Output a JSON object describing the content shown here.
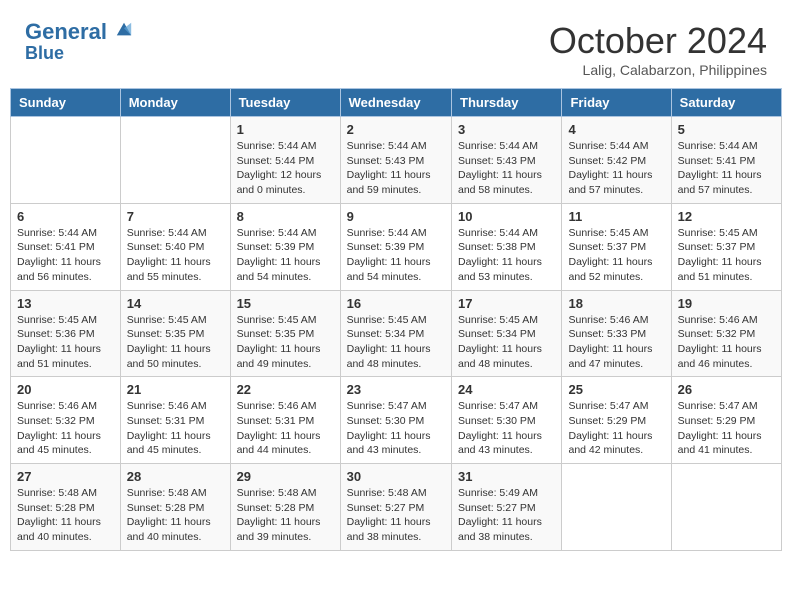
{
  "header": {
    "logo_line1": "General",
    "logo_line2": "Blue",
    "month_title": "October 2024",
    "subtitle": "Lalig, Calabarzon, Philippines"
  },
  "days_of_week": [
    "Sunday",
    "Monday",
    "Tuesday",
    "Wednesday",
    "Thursday",
    "Friday",
    "Saturday"
  ],
  "weeks": [
    [
      {
        "day": "",
        "content": ""
      },
      {
        "day": "",
        "content": ""
      },
      {
        "day": "1",
        "content": "Sunrise: 5:44 AM\nSunset: 5:44 PM\nDaylight: 12 hours and 0 minutes."
      },
      {
        "day": "2",
        "content": "Sunrise: 5:44 AM\nSunset: 5:43 PM\nDaylight: 11 hours and 59 minutes."
      },
      {
        "day": "3",
        "content": "Sunrise: 5:44 AM\nSunset: 5:43 PM\nDaylight: 11 hours and 58 minutes."
      },
      {
        "day": "4",
        "content": "Sunrise: 5:44 AM\nSunset: 5:42 PM\nDaylight: 11 hours and 57 minutes."
      },
      {
        "day": "5",
        "content": "Sunrise: 5:44 AM\nSunset: 5:41 PM\nDaylight: 11 hours and 57 minutes."
      }
    ],
    [
      {
        "day": "6",
        "content": "Sunrise: 5:44 AM\nSunset: 5:41 PM\nDaylight: 11 hours and 56 minutes."
      },
      {
        "day": "7",
        "content": "Sunrise: 5:44 AM\nSunset: 5:40 PM\nDaylight: 11 hours and 55 minutes."
      },
      {
        "day": "8",
        "content": "Sunrise: 5:44 AM\nSunset: 5:39 PM\nDaylight: 11 hours and 54 minutes."
      },
      {
        "day": "9",
        "content": "Sunrise: 5:44 AM\nSunset: 5:39 PM\nDaylight: 11 hours and 54 minutes."
      },
      {
        "day": "10",
        "content": "Sunrise: 5:44 AM\nSunset: 5:38 PM\nDaylight: 11 hours and 53 minutes."
      },
      {
        "day": "11",
        "content": "Sunrise: 5:45 AM\nSunset: 5:37 PM\nDaylight: 11 hours and 52 minutes."
      },
      {
        "day": "12",
        "content": "Sunrise: 5:45 AM\nSunset: 5:37 PM\nDaylight: 11 hours and 51 minutes."
      }
    ],
    [
      {
        "day": "13",
        "content": "Sunrise: 5:45 AM\nSunset: 5:36 PM\nDaylight: 11 hours and 51 minutes."
      },
      {
        "day": "14",
        "content": "Sunrise: 5:45 AM\nSunset: 5:35 PM\nDaylight: 11 hours and 50 minutes."
      },
      {
        "day": "15",
        "content": "Sunrise: 5:45 AM\nSunset: 5:35 PM\nDaylight: 11 hours and 49 minutes."
      },
      {
        "day": "16",
        "content": "Sunrise: 5:45 AM\nSunset: 5:34 PM\nDaylight: 11 hours and 48 minutes."
      },
      {
        "day": "17",
        "content": "Sunrise: 5:45 AM\nSunset: 5:34 PM\nDaylight: 11 hours and 48 minutes."
      },
      {
        "day": "18",
        "content": "Sunrise: 5:46 AM\nSunset: 5:33 PM\nDaylight: 11 hours and 47 minutes."
      },
      {
        "day": "19",
        "content": "Sunrise: 5:46 AM\nSunset: 5:32 PM\nDaylight: 11 hours and 46 minutes."
      }
    ],
    [
      {
        "day": "20",
        "content": "Sunrise: 5:46 AM\nSunset: 5:32 PM\nDaylight: 11 hours and 45 minutes."
      },
      {
        "day": "21",
        "content": "Sunrise: 5:46 AM\nSunset: 5:31 PM\nDaylight: 11 hours and 45 minutes."
      },
      {
        "day": "22",
        "content": "Sunrise: 5:46 AM\nSunset: 5:31 PM\nDaylight: 11 hours and 44 minutes."
      },
      {
        "day": "23",
        "content": "Sunrise: 5:47 AM\nSunset: 5:30 PM\nDaylight: 11 hours and 43 minutes."
      },
      {
        "day": "24",
        "content": "Sunrise: 5:47 AM\nSunset: 5:30 PM\nDaylight: 11 hours and 43 minutes."
      },
      {
        "day": "25",
        "content": "Sunrise: 5:47 AM\nSunset: 5:29 PM\nDaylight: 11 hours and 42 minutes."
      },
      {
        "day": "26",
        "content": "Sunrise: 5:47 AM\nSunset: 5:29 PM\nDaylight: 11 hours and 41 minutes."
      }
    ],
    [
      {
        "day": "27",
        "content": "Sunrise: 5:48 AM\nSunset: 5:28 PM\nDaylight: 11 hours and 40 minutes."
      },
      {
        "day": "28",
        "content": "Sunrise: 5:48 AM\nSunset: 5:28 PM\nDaylight: 11 hours and 40 minutes."
      },
      {
        "day": "29",
        "content": "Sunrise: 5:48 AM\nSunset: 5:28 PM\nDaylight: 11 hours and 39 minutes."
      },
      {
        "day": "30",
        "content": "Sunrise: 5:48 AM\nSunset: 5:27 PM\nDaylight: 11 hours and 38 minutes."
      },
      {
        "day": "31",
        "content": "Sunrise: 5:49 AM\nSunset: 5:27 PM\nDaylight: 11 hours and 38 minutes."
      },
      {
        "day": "",
        "content": ""
      },
      {
        "day": "",
        "content": ""
      }
    ]
  ]
}
